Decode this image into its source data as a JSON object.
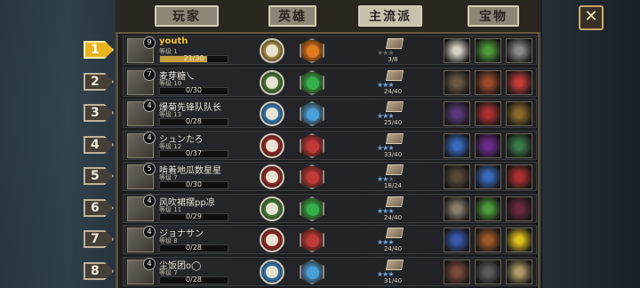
{
  "tabs": [
    {
      "label": "玩家",
      "active": false
    },
    {
      "label": "英雄",
      "active": false
    },
    {
      "label": "主流派",
      "active": true
    },
    {
      "label": "宝物",
      "active": false
    }
  ],
  "close_label": "✕",
  "level_label": "等级",
  "players": [
    {
      "rank": "1",
      "name": "youth",
      "level": "1",
      "progress": "21/30",
      "fill": 0.7,
      "hero_color": "#c6a24a",
      "gem_color": "#e07b1e",
      "stars_on": 0,
      "stars_total": 3,
      "score": "3/8",
      "items": [
        "#d7d2c6",
        "#4f9a3a",
        "#8a8a8a"
      ],
      "is_self": true,
      "badge": "9"
    },
    {
      "rank": "2",
      "name": "麦芽糖乀",
      "level": "10",
      "progress": "0/30",
      "fill": 0,
      "hero_color": "#4f8e3b",
      "gem_color": "#35b04a",
      "stars_on": 3,
      "stars_total": 3,
      "score": "24/40",
      "items": [
        "#6a5a44",
        "#9c4a2a",
        "#c23a3a"
      ],
      "is_self": false,
      "badge": "7"
    },
    {
      "rank": "3",
      "name": "爆菊先锋队队长",
      "level": "13",
      "progress": "0/28",
      "fill": 0,
      "hero_color": "#3a8fd0",
      "gem_color": "#4aa0d8",
      "stars_on": 3,
      "stars_total": 3,
      "score": "25/40",
      "items": [
        "#5a3a7a",
        "#b03030",
        "#8a6a2a"
      ],
      "is_self": false,
      "badge": "4"
    },
    {
      "rank": "4",
      "name": "シュンたろ",
      "level": "12",
      "progress": "0/37",
      "fill": 0,
      "hero_color": "#b02a2a",
      "gem_color": "#c03a3a",
      "stars_on": 3,
      "stars_total": 3,
      "score": "33/40",
      "items": [
        "#3a6ac0",
        "#6a2a8a",
        "#3a7a4a"
      ],
      "is_self": false,
      "badge": "4"
    },
    {
      "rank": "5",
      "name": "啃着地瓜数星星",
      "level": "7",
      "progress": "0/30",
      "fill": 0,
      "hero_color": "#b02a2a",
      "gem_color": "#c03a3a",
      "stars_on": 2,
      "stars_total": 3,
      "score": "18/24",
      "items": [
        "#5a4a3a",
        "#3a6ac0",
        "#b03030"
      ],
      "is_self": false,
      "badge": "5"
    },
    {
      "rank": "6",
      "name": "风吹裙摆pp凉",
      "level": "11",
      "progress": "0/29",
      "fill": 0,
      "hero_color": "#4f8e3b",
      "gem_color": "#35b04a",
      "stars_on": 3,
      "stars_total": 3,
      "score": "24/40",
      "items": [
        "#8a8270",
        "#4f9a3a",
        "#6a2a3a"
      ],
      "is_self": false,
      "badge": "4"
    },
    {
      "rank": "7",
      "name": "ジョナサン",
      "level": "8",
      "progress": "0/28",
      "fill": 0,
      "hero_color": "#b02a2a",
      "gem_color": "#c03a3a",
      "stars_on": 3,
      "stars_total": 3,
      "score": "24/40",
      "items": [
        "#3a5ab0",
        "#a05a2a",
        "#e0c020"
      ],
      "is_self": false,
      "badge": "4"
    },
    {
      "rank": "8",
      "name": "尘饭团o◯",
      "level": "7",
      "progress": "0/28",
      "fill": 0,
      "hero_color": "#3a8fd0",
      "gem_color": "#4aa0d8",
      "stars_on": 3,
      "stars_total": 3,
      "score": "31/40",
      "items": [
        "#7a4a3a",
        "#5a5a5a",
        "#b09a6a"
      ],
      "is_self": false,
      "badge": "4"
    }
  ]
}
